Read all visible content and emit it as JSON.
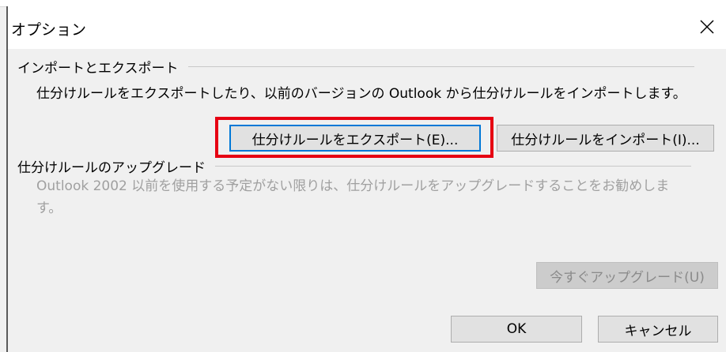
{
  "window": {
    "title": "オプション",
    "close_glyph": "✕"
  },
  "import_export": {
    "heading": "インポートとエクスポート",
    "description": "仕分けルールをエクスポートしたり、以前のバージョンの Outlook から仕分けルールをインポートします。",
    "export_button": "仕分けルールをエクスポート(E)...",
    "import_button": "仕分けルールをインポート(I)..."
  },
  "upgrade": {
    "heading": "仕分けルールのアップグレード",
    "description_line1": "Outlook 2002 以前を使用する予定がない限りは、仕分けルールをアップグレードすることをお勧めしま",
    "description_line2": "す。",
    "upgrade_button": "今すぐアップグレード(U)"
  },
  "footer": {
    "ok_button": "OK",
    "cancel_button": "キャンセル"
  },
  "annotation": {
    "highlight_color": "#e60012",
    "highlight_target": "export-rules-button"
  }
}
